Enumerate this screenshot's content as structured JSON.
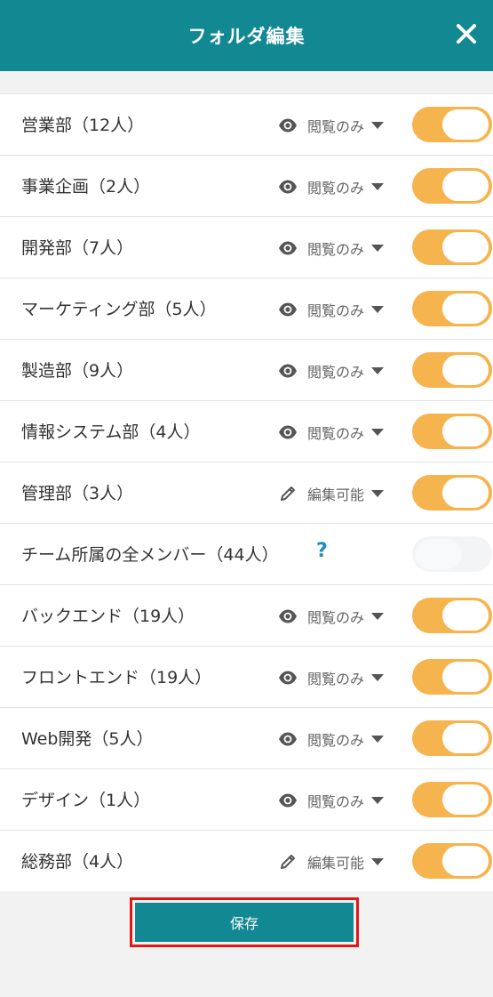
{
  "header": {
    "title": "フォルダ編集",
    "close_icon": "close-icon"
  },
  "rows": [
    {
      "name": "営業部（12人）",
      "perm": "閲覧のみ",
      "perm_icon": "eye-icon",
      "enabled": true
    },
    {
      "name": "事業企画（2人）",
      "perm": "閲覧のみ",
      "perm_icon": "eye-icon",
      "enabled": true
    },
    {
      "name": "開発部（7人）",
      "perm": "閲覧のみ",
      "perm_icon": "eye-icon",
      "enabled": true
    },
    {
      "name": "マーケティング部（5人）",
      "perm": "閲覧のみ",
      "perm_icon": "eye-icon",
      "enabled": true
    },
    {
      "name": "製造部（9人）",
      "perm": "閲覧のみ",
      "perm_icon": "eye-icon",
      "enabled": true
    },
    {
      "name": "情報システム部（4人）",
      "perm": "閲覧のみ",
      "perm_icon": "eye-icon",
      "enabled": true
    },
    {
      "name": "管理部（3人）",
      "perm": "編集可能",
      "perm_icon": "pencil-icon",
      "enabled": true
    },
    {
      "name": "チーム所属の全メンバー（44人）",
      "help": "?",
      "enabled": false
    },
    {
      "name": "バックエンド（19人）",
      "perm": "閲覧のみ",
      "perm_icon": "eye-icon",
      "enabled": true
    },
    {
      "name": "フロントエンド（19人）",
      "perm": "閲覧のみ",
      "perm_icon": "eye-icon",
      "enabled": true
    },
    {
      "name": "Web開発（5人）",
      "perm": "閲覧のみ",
      "perm_icon": "eye-icon",
      "enabled": true
    },
    {
      "name": "デザイン（1人）",
      "perm": "閲覧のみ",
      "perm_icon": "eye-icon",
      "enabled": true
    },
    {
      "name": "総務部（4人）",
      "perm": "編集可能",
      "perm_icon": "pencil-icon",
      "enabled": true
    }
  ],
  "footer": {
    "save_label": "保存"
  },
  "colors": {
    "header": "#128893",
    "toggle_on": "#f6b44e",
    "toggle_off": "#f3f4f6",
    "save_button": "#128893",
    "highlight_border": "#e01818",
    "help": "#1d8bbf"
  }
}
